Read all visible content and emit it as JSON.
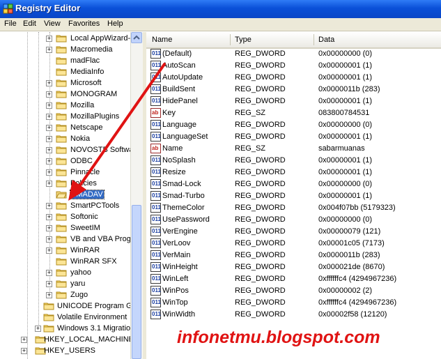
{
  "window": {
    "title": "Registry Editor"
  },
  "menu": [
    "File",
    "Edit",
    "View",
    "Favorites",
    "Help"
  ],
  "tree": [
    {
      "label": "Local AppWizard-G",
      "level": 3,
      "expand": true
    },
    {
      "label": "Macromedia",
      "level": 3,
      "expand": true
    },
    {
      "label": "madFlac",
      "level": 3,
      "expand": false
    },
    {
      "label": "MediaInfo",
      "level": 3,
      "expand": false
    },
    {
      "label": "Microsoft",
      "level": 3,
      "expand": true
    },
    {
      "label": "MONOGRAM",
      "level": 3,
      "expand": true
    },
    {
      "label": "Mozilla",
      "level": 3,
      "expand": true
    },
    {
      "label": "MozillaPlugins",
      "level": 3,
      "expand": true
    },
    {
      "label": "Netscape",
      "level": 3,
      "expand": true
    },
    {
      "label": "Nokia",
      "level": 3,
      "expand": true
    },
    {
      "label": "NOVOSTB Softwar",
      "level": 3,
      "expand": true
    },
    {
      "label": "ODBC",
      "level": 3,
      "expand": true
    },
    {
      "label": "Pinnacle",
      "level": 3,
      "expand": true
    },
    {
      "label": "Policies",
      "level": 3,
      "expand": true
    },
    {
      "label": "SMADAV",
      "level": 3,
      "expand": false,
      "selected": true
    },
    {
      "label": "SmartPCTools",
      "level": 3,
      "expand": true
    },
    {
      "label": "Softonic",
      "level": 3,
      "expand": true
    },
    {
      "label": "SweetIM",
      "level": 3,
      "expand": true
    },
    {
      "label": "VB and VBA Progra",
      "level": 3,
      "expand": true
    },
    {
      "label": "WinRAR",
      "level": 3,
      "expand": true
    },
    {
      "label": "WinRAR SFX",
      "level": 3,
      "expand": false
    },
    {
      "label": "yahoo",
      "level": 3,
      "expand": true
    },
    {
      "label": "yaru",
      "level": 3,
      "expand": true
    },
    {
      "label": "Zugo",
      "level": 3,
      "expand": true
    },
    {
      "label": "UNICODE Program Gro",
      "level": 2,
      "expand": false
    },
    {
      "label": "Volatile Environment",
      "level": 2,
      "expand": false
    },
    {
      "label": "Windows 3.1 Migration",
      "level": 2,
      "expand": true
    },
    {
      "label": "HKEY_LOCAL_MACHINE",
      "level": 1,
      "expand": true
    },
    {
      "label": "HKEY_USERS",
      "level": 1,
      "expand": true
    }
  ],
  "columns": {
    "name": "Name",
    "type": "Type",
    "data": "Data"
  },
  "values": [
    {
      "icon": "dword",
      "name": "(Default)",
      "type": "REG_DWORD",
      "data": "0x00000000 (0)"
    },
    {
      "icon": "dword",
      "name": "AutoScan",
      "type": "REG_DWORD",
      "data": "0x00000001 (1)"
    },
    {
      "icon": "dword",
      "name": "AutoUpdate",
      "type": "REG_DWORD",
      "data": "0x00000001 (1)"
    },
    {
      "icon": "dword",
      "name": "BuildSent",
      "type": "REG_DWORD",
      "data": "0x0000011b (283)"
    },
    {
      "icon": "dword",
      "name": "HidePanel",
      "type": "REG_DWORD",
      "data": "0x00000001 (1)"
    },
    {
      "icon": "sz",
      "name": "Key",
      "type": "REG_SZ",
      "data": "083800784531"
    },
    {
      "icon": "dword",
      "name": "Language",
      "type": "REG_DWORD",
      "data": "0x00000000 (0)"
    },
    {
      "icon": "dword",
      "name": "LanguageSet",
      "type": "REG_DWORD",
      "data": "0x00000001 (1)"
    },
    {
      "icon": "sz",
      "name": "Name",
      "type": "REG_SZ",
      "data": "sabarmuanas"
    },
    {
      "icon": "dword",
      "name": "NoSplash",
      "type": "REG_DWORD",
      "data": "0x00000001 (1)"
    },
    {
      "icon": "dword",
      "name": "Resize",
      "type": "REG_DWORD",
      "data": "0x00000001 (1)"
    },
    {
      "icon": "dword",
      "name": "Smad-Lock",
      "type": "REG_DWORD",
      "data": "0x00000000 (0)"
    },
    {
      "icon": "dword",
      "name": "Smad-Turbo",
      "type": "REG_DWORD",
      "data": "0x00000001 (1)"
    },
    {
      "icon": "dword",
      "name": "ThemeColor",
      "type": "REG_DWORD",
      "data": "0x004f07bb (5179323)"
    },
    {
      "icon": "dword",
      "name": "UsePassword",
      "type": "REG_DWORD",
      "data": "0x00000000 (0)"
    },
    {
      "icon": "dword",
      "name": "VerEngine",
      "type": "REG_DWORD",
      "data": "0x00000079 (121)"
    },
    {
      "icon": "dword",
      "name": "VerLoov",
      "type": "REG_DWORD",
      "data": "0x00001c05 (7173)"
    },
    {
      "icon": "dword",
      "name": "VerMain",
      "type": "REG_DWORD",
      "data": "0x0000011b (283)"
    },
    {
      "icon": "dword",
      "name": "WinHeight",
      "type": "REG_DWORD",
      "data": "0x000021de (8670)"
    },
    {
      "icon": "dword",
      "name": "WinLeft",
      "type": "REG_DWORD",
      "data": "0xffffffc4 (4294967236)"
    },
    {
      "icon": "dword",
      "name": "WinPos",
      "type": "REG_DWORD",
      "data": "0x00000002 (2)"
    },
    {
      "icon": "dword",
      "name": "WinTop",
      "type": "REG_DWORD",
      "data": "0xffffffc4 (4294967236)"
    },
    {
      "icon": "dword",
      "name": "WinWidth",
      "type": "REG_DWORD",
      "data": "0x00002f58 (12120)"
    }
  ],
  "icon_labels": {
    "dword": "011",
    "sz": "ab"
  },
  "watermark": "infonetmu.blogspot.com",
  "colors": {
    "accent": "#e01313",
    "selection": "#316ac5"
  }
}
